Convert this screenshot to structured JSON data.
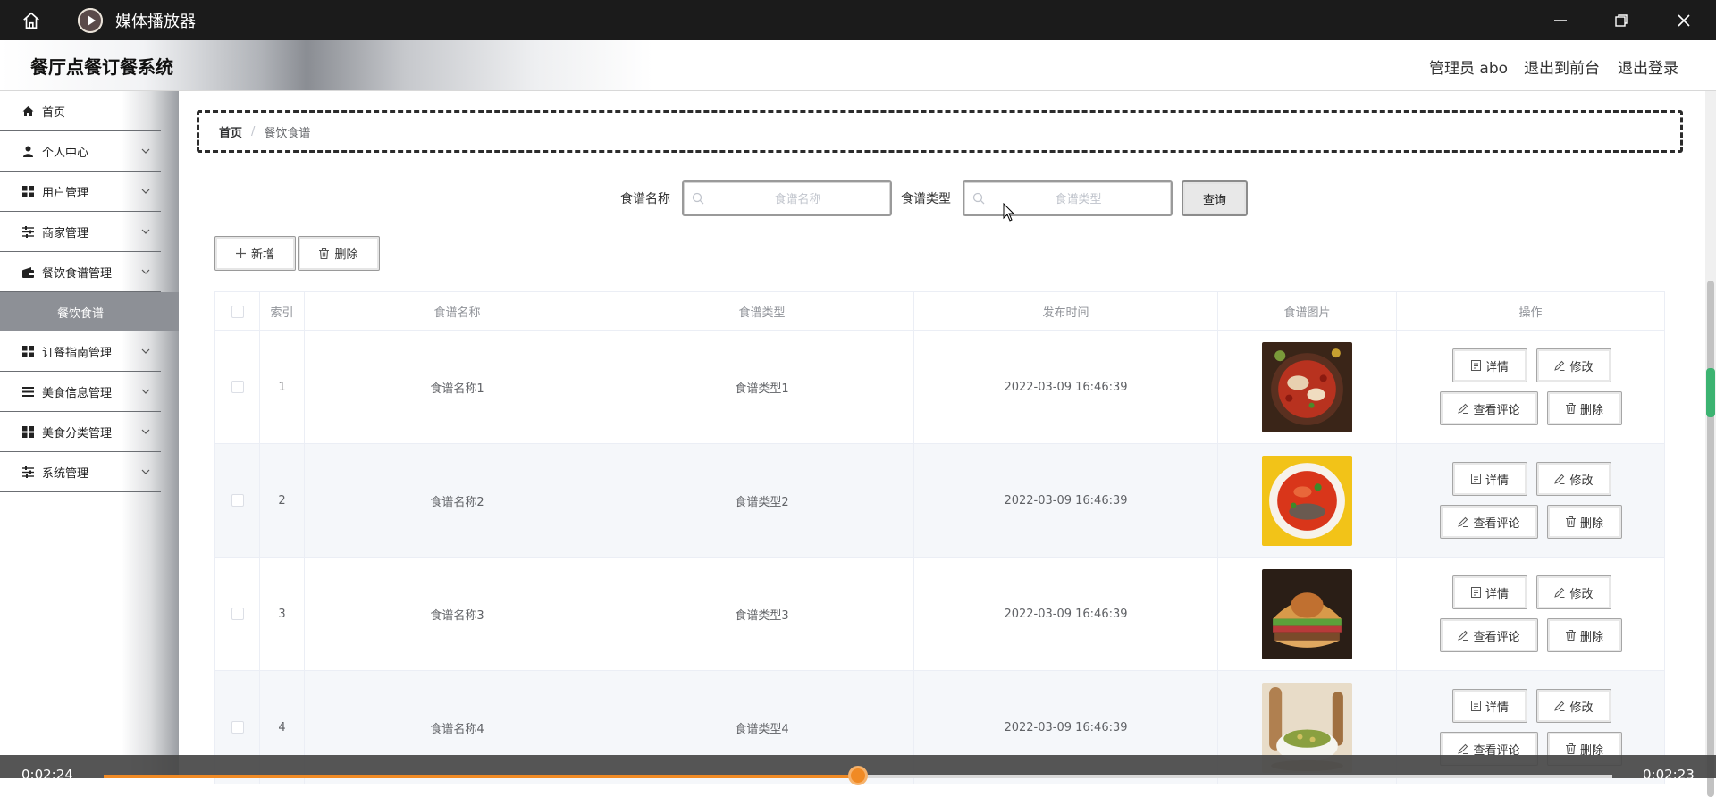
{
  "player": {
    "app_title": "媒体播放器",
    "elapsed": "0:02:24",
    "remaining": "0:02:23",
    "progress_fraction": 0.5
  },
  "header": {
    "title": "餐厅点餐订餐系统",
    "admin": "管理员 abo",
    "front": "退出到前台",
    "logout": "退出登录"
  },
  "sidebar": {
    "items": [
      {
        "label": "首页",
        "icon": "home-icon"
      },
      {
        "label": "个人中心",
        "icon": "user-icon"
      },
      {
        "label": "用户管理",
        "icon": "grid-icon"
      },
      {
        "label": "商家管理",
        "icon": "sliders-icon"
      },
      {
        "label": "餐饮食谱管理",
        "icon": "wallet-icon"
      },
      {
        "label": "餐饮食谱",
        "icon": ""
      },
      {
        "label": "订餐指南管理",
        "icon": "grid-icon"
      },
      {
        "label": "美食信息管理",
        "icon": "list-icon"
      },
      {
        "label": "美食分类管理",
        "icon": "grid-icon"
      },
      {
        "label": "系统管理",
        "icon": "sliders-icon"
      }
    ]
  },
  "breadcrumb": {
    "home": "首页",
    "sep": "/",
    "current": "餐饮食谱"
  },
  "search": {
    "name_label": "食谱名称",
    "name_placeholder": "食谱名称",
    "type_label": "食谱类型",
    "type_placeholder": "食谱类型",
    "query": "查询"
  },
  "actions": {
    "add": "新增",
    "delete": "删除"
  },
  "table": {
    "headers": [
      "索引",
      "食谱名称",
      "食谱类型",
      "发布时间",
      "食谱图片",
      "操作"
    ],
    "ops": {
      "detail": "详情",
      "edit": "修改",
      "comments": "查看评论",
      "delete": "删除"
    },
    "rows": [
      {
        "index": "1",
        "name": "食谱名称1",
        "type": "食谱类型1",
        "time": "2022-03-09 16:46:39"
      },
      {
        "index": "2",
        "name": "食谱名称2",
        "type": "食谱类型2",
        "time": "2022-03-09 16:46:39"
      },
      {
        "index": "3",
        "name": "食谱名称3",
        "type": "食谱类型3",
        "time": "2022-03-09 16:46:39"
      },
      {
        "index": "4",
        "name": "食谱名称4",
        "type": "食谱类型4",
        "time": "2022-03-09 16:46:39"
      }
    ]
  },
  "colors": {
    "accent": "#f08a24",
    "sidebar_active": "#8d9096",
    "scroll_marker": "#3cb371"
  }
}
